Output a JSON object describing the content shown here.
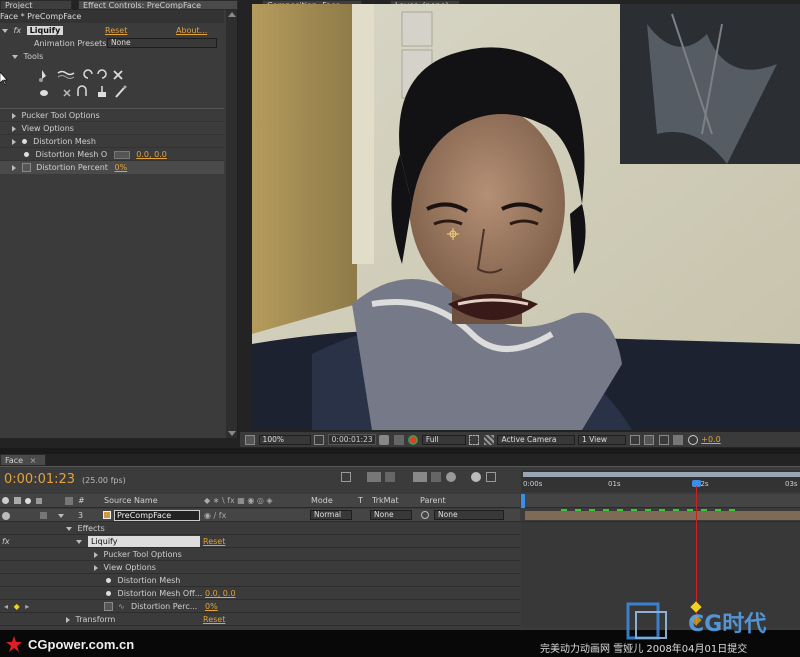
{
  "tabs": {
    "project": "Project",
    "effect_controls": "Effect Controls: PreCompFace",
    "composition": "Composition: Face",
    "layer": "Layer: (none)"
  },
  "effect_panel": {
    "breadcrumb": "Face * PreCompFace",
    "effect_name": "Liquify",
    "reset": "Reset",
    "about": "About...",
    "animation_presets_label": "Animation Presets:",
    "animation_presets_value": "None",
    "tools_label": "Tools",
    "pucker_tool_options": "Pucker Tool Options",
    "view_options": "View Options",
    "distortion_mesh": "Distortion Mesh",
    "distortion_mesh_offset": "Distortion Mesh O",
    "distortion_mesh_offset_value": "0.0, 0.0",
    "distortion_percent": "Distortion Percent",
    "distortion_percent_value": "0%"
  },
  "comp_toolbar": {
    "zoom": "100%",
    "timecode": "0:00:01:23",
    "resolution": "Full",
    "camera": "Active Camera",
    "view": "1 View",
    "exposure": "+0.0"
  },
  "timeline": {
    "tab": "Face",
    "timecode": "0:00:01:23",
    "fps": "(25.00 fps)",
    "columns": {
      "number": "#",
      "source_name": "Source Name",
      "mode": "Mode",
      "t": "T",
      "trkmat": "TrkMat",
      "parent": "Parent"
    },
    "layer": {
      "number": "3",
      "name": "PreCompFace",
      "mode": "Normal",
      "trkmat": "None",
      "parent": "None"
    },
    "rows": {
      "effects": "Effects",
      "liquify": "Liquify",
      "reset": "Reset",
      "pucker_tool_options": "Pucker Tool Options",
      "view_options": "View Options",
      "distortion_mesh": "Distortion Mesh",
      "distortion_mesh_offset": "Distortion Mesh Off...",
      "distortion_mesh_offset_value": "0.0, 0.0",
      "distortion_percent": "Distortion Perc...",
      "distortion_percent_value": "0%",
      "transform": "Transform",
      "transform_reset": "Reset"
    },
    "ruler": [
      "0:00s",
      "01s",
      "02s",
      "03s"
    ]
  },
  "watermarks": {
    "site": "CGpower.com.cn",
    "credit": "完美动力动画网 雪娅儿 2008年04月01日提交",
    "logo": "CG时代"
  },
  "colors": {
    "accent_orange": "#e3a33c",
    "cti_red": "#d02020",
    "keyframe_yellow": "#f0d020"
  }
}
